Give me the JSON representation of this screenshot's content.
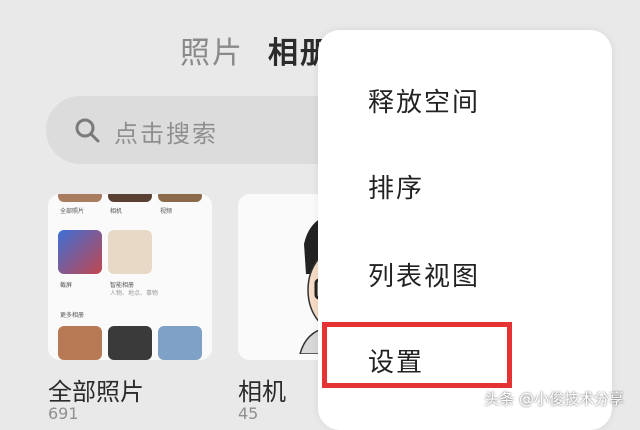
{
  "header": {
    "tabs": [
      {
        "label": "照片",
        "active": false
      },
      {
        "label": "相册",
        "active": true
      }
    ]
  },
  "search": {
    "placeholder": "点击搜索"
  },
  "albums": [
    {
      "name": "全部照片",
      "count": "691",
      "preview": {
        "top_labels": [
          "全部照片",
          "相机",
          "视频"
        ],
        "mid_labels": [
          "截屏",
          "智能相册"
        ],
        "mid_sub": "人物、地点、事物",
        "section_label": "更多相册"
      }
    },
    {
      "name": "相机",
      "count": "45"
    }
  ],
  "menu": {
    "items": [
      "释放空间",
      "排序",
      "列表视图",
      "设置"
    ],
    "highlighted": "设置",
    "highlight_color": "#e53232"
  },
  "watermark": "头条 @小俊技术分享"
}
